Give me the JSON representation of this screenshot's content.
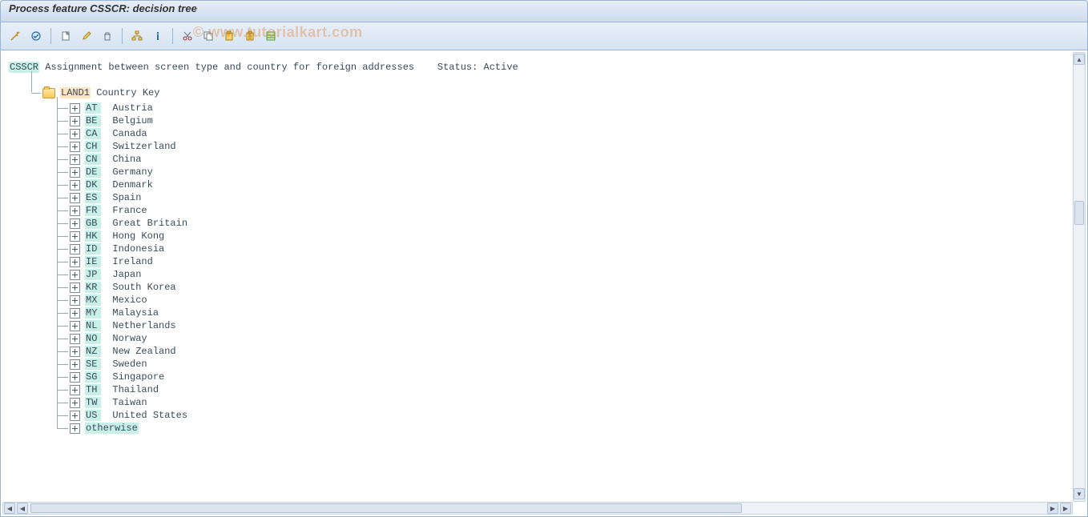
{
  "title": "Process feature CSSCR: decision tree",
  "watermark": "© www.tutorialkart.com",
  "root": {
    "code": "CSSCR",
    "desc": "Assignment between screen type and country for foreign addresses",
    "status_label": "Status:",
    "status_value": "Active"
  },
  "group": {
    "code": "LAND1",
    "desc": "Country Key"
  },
  "items": [
    {
      "code": "AT",
      "desc": "Austria"
    },
    {
      "code": "BE",
      "desc": "Belgium"
    },
    {
      "code": "CA",
      "desc": "Canada"
    },
    {
      "code": "CH",
      "desc": "Switzerland"
    },
    {
      "code": "CN",
      "desc": "China"
    },
    {
      "code": "DE",
      "desc": "Germany"
    },
    {
      "code": "DK",
      "desc": "Denmark"
    },
    {
      "code": "ES",
      "desc": "Spain"
    },
    {
      "code": "FR",
      "desc": "France"
    },
    {
      "code": "GB",
      "desc": "Great Britain"
    },
    {
      "code": "HK",
      "desc": "Hong Kong"
    },
    {
      "code": "ID",
      "desc": "Indonesia"
    },
    {
      "code": "IE",
      "desc": "Ireland"
    },
    {
      "code": "JP",
      "desc": "Japan"
    },
    {
      "code": "KR",
      "desc": "South Korea"
    },
    {
      "code": "MX",
      "desc": "Mexico"
    },
    {
      "code": "MY",
      "desc": "Malaysia"
    },
    {
      "code": "NL",
      "desc": "Netherlands"
    },
    {
      "code": "NO",
      "desc": "Norway"
    },
    {
      "code": "NZ",
      "desc": "New Zealand"
    },
    {
      "code": "SE",
      "desc": "Sweden"
    },
    {
      "code": "SG",
      "desc": "Singapore"
    },
    {
      "code": "TH",
      "desc": "Thailand"
    },
    {
      "code": "TW",
      "desc": "Taiwan"
    },
    {
      "code": "US",
      "desc": "United States"
    },
    {
      "code": "otherwise",
      "desc": ""
    }
  ]
}
